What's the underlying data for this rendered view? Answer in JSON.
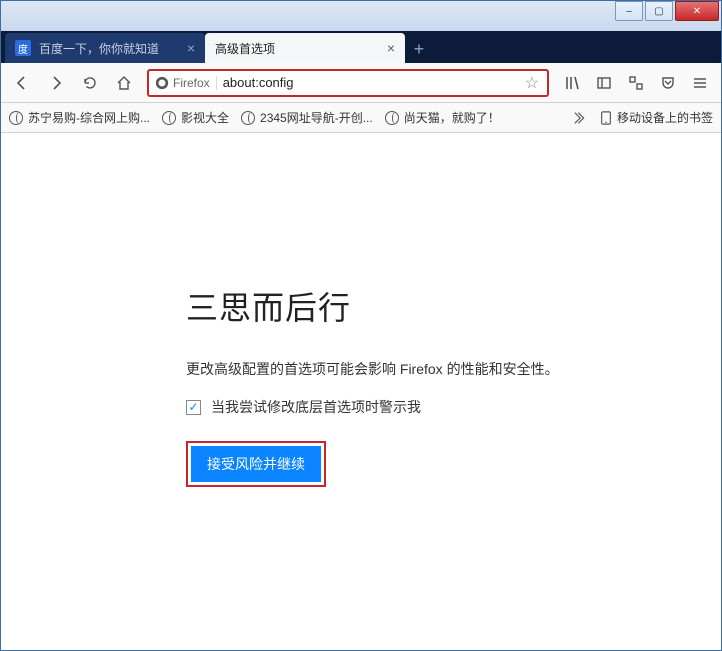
{
  "window": {
    "minimize": "–",
    "maximize": "▢",
    "close": "✕"
  },
  "tabs": [
    {
      "title": "百度一下，你你就知道",
      "active": false
    },
    {
      "title": "高级首选项",
      "active": true
    }
  ],
  "nav": {
    "firefox_label": "Firefox",
    "url": "about:config"
  },
  "bookmarks": {
    "items": [
      "苏宁易购-综合网上购...",
      "影视大全",
      "2345网址导航-开创...",
      "尚天猫，就购了！"
    ],
    "mobile": "移动设备上的书签"
  },
  "page": {
    "heading": "三思而后行",
    "subtext": "更改高级配置的首选项可能会影响 Firefox 的性能和安全性。",
    "checkbox_label": "当我尝试修改底层首选项时警示我",
    "accept_button": "接受风险并继续"
  }
}
